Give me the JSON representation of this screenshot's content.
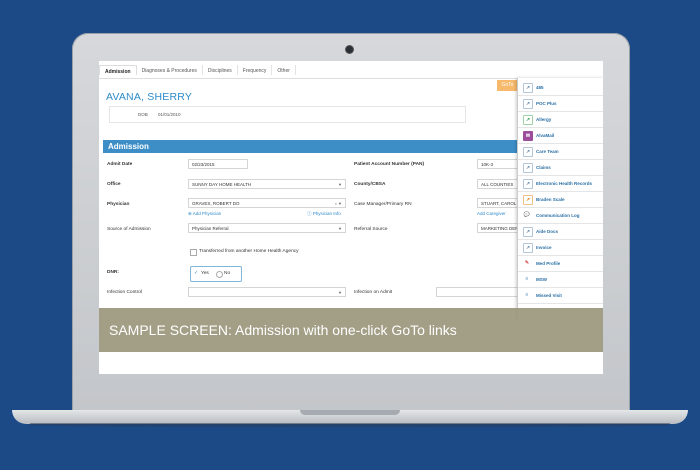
{
  "tabs": [
    "Admission",
    "Diagnoses & Procedures",
    "Disciplines",
    "Frequency",
    "Other"
  ],
  "patient": {
    "name": "AVANA, SHERRY",
    "dob_label": "DOB",
    "dob_value": "01/01/2010"
  },
  "goto_button": "GoTo",
  "section_title": "Admission",
  "form": {
    "admit_date_label": "Admit Date",
    "admit_date_value": "02/23/2015",
    "pan_label": "Patient Account Number (PAN)",
    "pan_value": "10K-3",
    "office_label": "Office",
    "office_value": "SUNNY DAY HOME HEALTH",
    "county_label": "County/CBSA",
    "county_value": "ALL COUNTIES",
    "physician_label": "Physician",
    "physician_value": "GRAVES, ROBERT DO",
    "add_physician": "Add Physician",
    "physician_info": "Physician Info",
    "case_manager_label": "Case Manager/Primary RN",
    "case_manager_value": "STUART, CAROL",
    "add_caregiver": "Add Caregiver",
    "source_label": "Source of Admission",
    "source_value": "Physician Referral",
    "referral_label": "Referral Source",
    "referral_value": "MARKETING DEPT",
    "transferred_label": "Transferred from another Home Health Agency",
    "dnr_label": "DNR:",
    "dnr_yes": "Yes",
    "dnr_no": "No",
    "infection_control_label": "Infection Control",
    "infection_admit_label": "Infection on Admit"
  },
  "goto_menu": [
    {
      "label": "485",
      "icon": "external-link-icon"
    },
    {
      "label": "POC Plus",
      "icon": "external-link-icon"
    },
    {
      "label": "Allergy",
      "icon": "external-link-icon"
    },
    {
      "label": "AlvaMail",
      "icon": "mail-icon"
    },
    {
      "label": "Care Team",
      "icon": "external-link-icon"
    },
    {
      "label": "Claims",
      "icon": "external-link-icon"
    },
    {
      "label": "Electronic Health Records",
      "icon": "external-link-icon"
    },
    {
      "label": "Braden Scale",
      "icon": "external-link-icon"
    },
    {
      "label": "Communication Log",
      "icon": "chat-icon"
    },
    {
      "label": "Aide Docs",
      "icon": "external-link-icon"
    },
    {
      "label": "Invoice",
      "icon": "external-link-icon"
    },
    {
      "label": "Med Profile",
      "icon": "pill-icon"
    },
    {
      "label": "MSW",
      "icon": "list-icon"
    },
    {
      "label": "Missed Visit",
      "icon": "list-icon"
    }
  ],
  "banner": "SAMPLE SCREEN: Admission with one-click GoTo links"
}
